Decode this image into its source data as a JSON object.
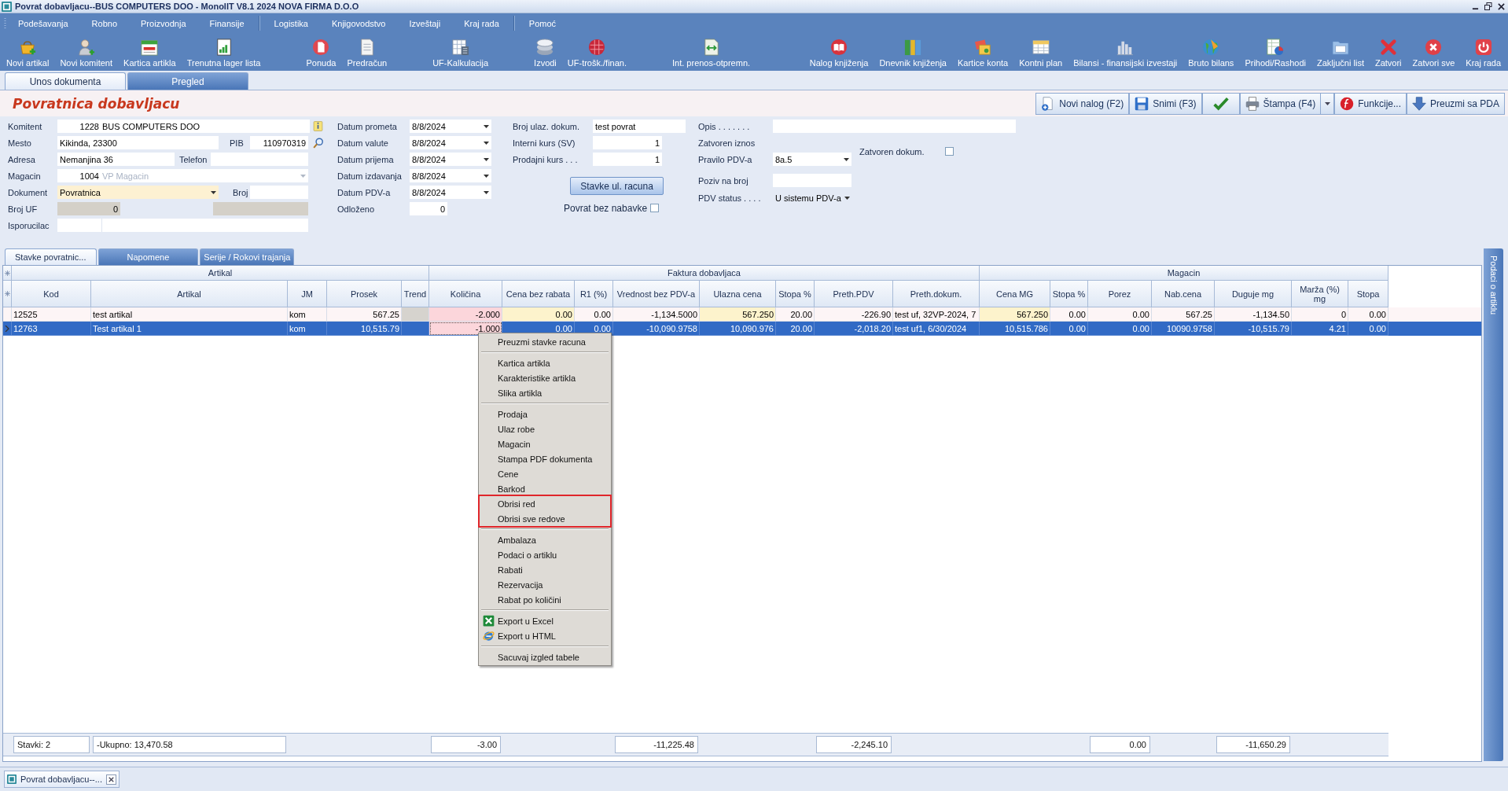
{
  "window": {
    "title": "Povrat dobavljacu--BUS COMPUTERS DOO - MonolIT V8.1 2024 NOVA FIRMA D.O.O"
  },
  "menu_bar": [
    {
      "items": [
        "Podešavanja",
        "Robno",
        "Proizvodnja",
        "Finansije"
      ]
    },
    {
      "items": [
        "Logistika",
        "Knjigovodstvo",
        "Izveštaji",
        "Kraj rada"
      ]
    },
    {
      "items": [
        "Pomoć"
      ]
    }
  ],
  "toolbar": [
    {
      "items": [
        "Novi artikal",
        "Novi komitent",
        "Kartica artikla",
        "Trenutna lager lista"
      ]
    },
    {
      "items": [
        "Ponuda",
        "Predračun"
      ]
    },
    {
      "items": [
        "UF-Kalkulacija"
      ]
    },
    {
      "items": [
        "Izvodi",
        "UF-trošk./finan."
      ]
    },
    {
      "items": [
        "Int. prenos-otpremn."
      ]
    },
    {
      "items": [
        "Nalog knjiženja",
        "Dnevnik knjiženja",
        "Kartice konta",
        "Kontni plan",
        "Bilansi - finansijski izvestaji",
        "Bruto bilans",
        "Prihodi/Rashodi",
        "Zaključni list",
        "Zatvori",
        "Zatvori sve",
        "Kraj rada"
      ]
    }
  ],
  "page_tabs": [
    {
      "label": "Unos dokumenta",
      "selected": true
    },
    {
      "label": "Pregled",
      "selected": false
    }
  ],
  "document": {
    "title": "Povratnica dobavljacu",
    "actions": [
      {
        "kind": "new",
        "label": "Novi nalog (F2)"
      },
      {
        "kind": "save",
        "label": "Snimi (F3)"
      },
      {
        "kind": "confirm"
      },
      {
        "kind": "print",
        "label": "Štampa (F4)"
      },
      {
        "kind": "functions",
        "label": "Funkcije..."
      },
      {
        "kind": "download",
        "label": "Preuzmi sa PDA"
      }
    ]
  },
  "form": {
    "komitent": {
      "label": "Komitent",
      "code": "1228",
      "value": "BUS COMPUTERS DOO"
    },
    "mesto": {
      "label": "Mesto",
      "value": "Kikinda, 23300"
    },
    "pib": {
      "label": "PIB",
      "value": "110970319"
    },
    "adresa": {
      "label": "Adresa",
      "value": "Nemanjina 36"
    },
    "telefon": {
      "label": "Telefon"
    },
    "magacin": {
      "label": "Magacin",
      "code": "1004",
      "value": "VP Magacin",
      "disabled": true
    },
    "dokument": {
      "label": "Dokument",
      "value": "Povratnica"
    },
    "broj": {
      "label": "Broj"
    },
    "broj_uf": {
      "label": "Broj UF",
      "value": "0"
    },
    "isporucilac": {
      "label": "Isporucilac"
    },
    "dates": [
      {
        "label": "Datum prometa",
        "value": "8/8/2024"
      },
      {
        "label": "Datum valute",
        "value": "8/8/2024"
      },
      {
        "label": "Datum prijema",
        "value": "8/8/2024"
      },
      {
        "label": "Datum izdavanja",
        "value": "8/8/2024"
      },
      {
        "label": "Datum PDV-a",
        "value": "8/8/2024"
      }
    ],
    "odlozeno": {
      "label": "Odloženo",
      "value": "0"
    },
    "broj_ulaz": {
      "label": "Broj ulaz. dokum.",
      "value": "test povrat"
    },
    "interni_kurs": {
      "label": "Interni kurs (SV)",
      "value": "1"
    },
    "prodajni_kurs": {
      "label": "Prodajni kurs . . .",
      "value": "1"
    },
    "stavke_button": "Stavke ul. racuna",
    "povrat_bez_nabavke": {
      "label": "Povrat bez nabavke",
      "checked": false
    },
    "opis": {
      "label": "Opis . . . . . . ."
    },
    "zatvoren_iznos": {
      "label": "Zatvoren iznos"
    },
    "pravilo_pdv": {
      "label": "Pravilo PDV-a",
      "value": "8a.5"
    },
    "poziv": {
      "label": "Poziv na broj"
    },
    "pdv_status": {
      "label": "PDV status . . . .",
      "value": "U sistemu PDV-a"
    },
    "zatvoren_dokum": {
      "label": "Zatvoren dokum.",
      "checked": false
    }
  },
  "detail_tabs": [
    {
      "label": "Stavke povratnic...",
      "selected": true
    },
    {
      "label": "Napomene",
      "selected": false
    },
    {
      "label": "Serije / Rokovi trajanja",
      "selected": false
    }
  ],
  "table": {
    "groups": [
      {
        "label": "Artikal",
        "columns": [
          {
            "label": "Kod",
            "kind": "text",
            "total": "Stavki: 2"
          },
          {
            "label": "Artikal",
            "kind": "text",
            "total": "-Ukupno: 13,470.58"
          },
          {
            "label": "JM",
            "kind": "text"
          },
          {
            "label": "Prosek",
            "kind": "number"
          },
          {
            "label": "Trend",
            "kind": "shaded"
          }
        ]
      },
      {
        "label": "Faktura dobavljaca",
        "columns": [
          {
            "label": "Količina",
            "kind": "qty",
            "total": "-3.00"
          },
          {
            "label": "Cena bez rabata",
            "kind": "price"
          },
          {
            "label": "R1 (%)",
            "kind": "number"
          },
          {
            "label": "Vrednost bez PDV-a",
            "kind": "number",
            "total": "-11,225.48"
          },
          {
            "label": "Ulazna cena",
            "kind": "price"
          },
          {
            "label": "Stopa %",
            "kind": "number"
          },
          {
            "label": "Preth.PDV",
            "kind": "number",
            "total": "-2,245.10"
          },
          {
            "label": "Preth.dokum.",
            "kind": "text"
          }
        ]
      },
      {
        "label": "Magacin",
        "columns": [
          {
            "label": "Cena MG",
            "kind": "price"
          },
          {
            "label": "Stopa %",
            "kind": "number"
          },
          {
            "label": "Porez",
            "kind": "number",
            "total": "0.00"
          },
          {
            "label": "Nab.cena",
            "kind": "number"
          },
          {
            "label": "Duguje mg",
            "kind": "number",
            "total": "-11,650.29"
          },
          {
            "label": "Marža (%)\nmg",
            "kind": "number"
          },
          {
            "label": "Stopa",
            "kind": "number"
          }
        ]
      }
    ],
    "rows": [
      {
        "selected": false,
        "cells": [
          "12525",
          "test artikal",
          "kom",
          "567.25",
          null,
          "-2.000",
          "0.00",
          "0.00",
          "-1,134.5000",
          "567.250",
          "20.00",
          "-226.90",
          "test uf, 32VP-2024, 7",
          "567.250",
          "0.00",
          "0.00",
          "567.25",
          "-1,134.50",
          "0",
          "0.00"
        ]
      },
      {
        "selected": true,
        "cells": [
          "12763",
          "Test artikal 1",
          "kom",
          "10,515.79",
          null,
          "-1.000",
          "0.00",
          "0.00",
          "-10,090.9758",
          "10,090.976",
          "20.00",
          "-2,018.20",
          "test uf1, 6/30/2024",
          "10,515.786",
          "0.00",
          "0.00",
          "10090.9758",
          "-10,515.79",
          "4.21",
          "0.00"
        ]
      }
    ]
  },
  "context_menu": {
    "sections": [
      {
        "items": [
          {
            "label": "Preuzmi stavke racuna",
            "kind": "plain",
            "highlighted": false
          }
        ]
      },
      {
        "items": [
          {
            "label": "Kartica artikla",
            "kind": "plain",
            "highlighted": false
          },
          {
            "label": "Karakteristike artikla",
            "kind": "plain",
            "highlighted": false
          },
          {
            "label": "Slika artikla",
            "kind": "plain",
            "highlighted": false
          }
        ]
      },
      {
        "items": [
          {
            "label": "Prodaja",
            "kind": "plain",
            "highlighted": false
          },
          {
            "label": "Ulaz robe",
            "kind": "plain",
            "highlighted": false
          },
          {
            "label": "Magacin",
            "kind": "plain",
            "highlighted": false
          },
          {
            "label": "Stampa PDF dokumenta",
            "kind": "plain",
            "highlighted": false
          },
          {
            "label": "Cene",
            "kind": "plain",
            "highlighted": false
          },
          {
            "label": "Barkod",
            "kind": "plain",
            "highlighted": false
          },
          {
            "label": "Obrisi red",
            "kind": "plain",
            "highlighted": true
          },
          {
            "label": "Obrisi sve redove",
            "kind": "plain",
            "highlighted": true
          }
        ]
      },
      {
        "items": [
          {
            "label": "Ambalaza",
            "kind": "plain",
            "highlighted": false
          },
          {
            "label": "Podaci o artiklu",
            "kind": "plain",
            "highlighted": false
          },
          {
            "label": "Rabati",
            "kind": "plain",
            "highlighted": false
          },
          {
            "label": "Rezervacija",
            "kind": "plain",
            "highlighted": false
          },
          {
            "label": "Rabat po količini",
            "kind": "plain",
            "highlighted": false
          }
        ]
      },
      {
        "items": [
          {
            "label": "Export u Excel",
            "kind": "sheet-export",
            "highlighted": false
          },
          {
            "label": "Export u HTML",
            "kind": "web-export",
            "highlighted": false
          }
        ]
      },
      {
        "items": [
          {
            "label": "Sacuvaj izgled tabele",
            "kind": "plain",
            "highlighted": false
          }
        ]
      }
    ]
  },
  "side_panel": {
    "label": "Podaci o artiklu"
  },
  "taskbar": [
    {
      "label": "Povrat dobavljacu--...",
      "selected": true
    }
  ]
}
